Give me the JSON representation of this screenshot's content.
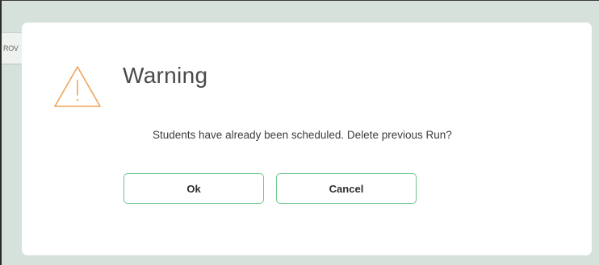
{
  "background": {
    "partial_button_label": "ROV"
  },
  "dialog": {
    "icon": "warning-triangle-icon",
    "title": "Warning",
    "message": "Students have already been scheduled. Delete previous Run?",
    "buttons": {
      "ok_label": "Ok",
      "cancel_label": "Cancel"
    }
  },
  "colors": {
    "warning_icon": "#f0a35c",
    "button_border": "#6fc78f",
    "overlay_background": "#d6e1db"
  }
}
